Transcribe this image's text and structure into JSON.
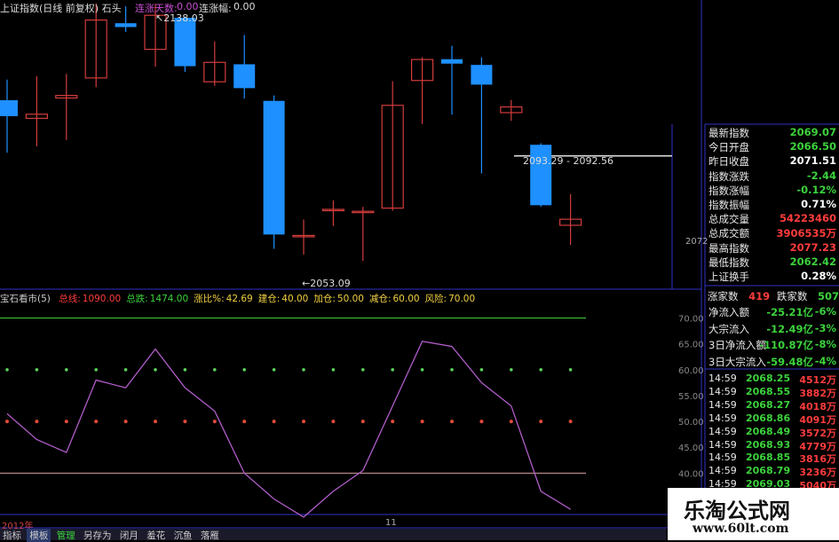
{
  "colors": {
    "up": "#d23c3c",
    "down": "#1e90ff",
    "purple": "#b05cc8",
    "green_dot": "#5ad25a",
    "red_dot": "#e84a3a",
    "frame": "#3232c8",
    "val_red": "#ff3c3c",
    "val_green": "#3cd23c",
    "yellow": "#f0d040"
  },
  "header": {
    "title": "上证指数(日线 前复权) 石头",
    "consec_days_label": "连涨天数:",
    "consec_days_value": "0.00",
    "consec_amp_label": "连涨幅:",
    "consec_amp_value": "0.00"
  },
  "price_annotations": {
    "high": "2138.03",
    "low": "←2053.09",
    "line_label": "2093.29 - 2092.56",
    "right_axis": "2072"
  },
  "chart_data": [
    {
      "type": "candlestick",
      "title": "上证指数(日线 前复权)",
      "ylim": [
        2050,
        2142
      ],
      "candles": [
        {
          "o": 2110.5,
          "c": 2105.5,
          "h": 2117.0,
          "l": 2094.0
        },
        {
          "o": 2104.8,
          "c": 2106.1,
          "h": 2118.0,
          "l": 2096.0
        },
        {
          "o": 2111.2,
          "c": 2112.0,
          "h": 2118.8,
          "l": 2098.0
        },
        {
          "o": 2117.5,
          "c": 2135.7,
          "h": 2141.0,
          "l": 2114.6
        },
        {
          "o": 2134.7,
          "c": 2133.5,
          "h": 2140.0,
          "l": 2132.0
        },
        {
          "o": 2126.5,
          "c": 2137.2,
          "h": 2140.8,
          "l": 2121.0
        },
        {
          "o": 2136.4,
          "c": 2121.2,
          "h": 2136.8,
          "l": 2119.4
        },
        {
          "o": 2116.3,
          "c": 2122.4,
          "h": 2129.0,
          "l": 2115.0
        },
        {
          "o": 2121.8,
          "c": 2114.3,
          "h": 2131.0,
          "l": 2111.0
        },
        {
          "o": 2110.3,
          "c": 2068.3,
          "h": 2112.0,
          "l": 2063.8
        },
        {
          "o": 2068.0,
          "c": 2068.0,
          "h": 2073.0,
          "l": 2062.0
        },
        {
          "o": 2076.2,
          "c": 2076.2,
          "h": 2079.0,
          "l": 2071.0
        },
        {
          "o": 2075.6,
          "c": 2075.6,
          "h": 2077.0,
          "l": 2060.0
        },
        {
          "o": 2076.6,
          "c": 2108.9,
          "h": 2116.5,
          "l": 2075.8
        },
        {
          "o": 2116.7,
          "c": 2123.3,
          "h": 2124.0,
          "l": 2103.0
        },
        {
          "o": 2123.4,
          "c": 2122.0,
          "h": 2127.6,
          "l": 2106.0
        },
        {
          "o": 2121.6,
          "c": 2115.4,
          "h": 2124.0,
          "l": 2087.5
        },
        {
          "o": 2106.6,
          "c": 2108.4,
          "h": 2110.6,
          "l": 2104.0
        },
        {
          "o": 2096.5,
          "c": 2077.5,
          "h": 2097.0,
          "l": 2077.0
        },
        {
          "o": 2071.2,
          "c": 2073.1,
          "h": 2081.0,
          "l": 2065.0
        }
      ],
      "hline": {
        "value": 2093.0,
        "label": "2093.29 - 2092.56"
      },
      "high_label": {
        "value": 2138.03,
        "index": 5
      },
      "low_label": {
        "value": 2053.09,
        "index": 11
      }
    },
    {
      "type": "line",
      "title": "宝石看市(5)",
      "ylim": [
        32,
        73
      ],
      "yticks": [
        35,
        40,
        45,
        50,
        55,
        60,
        65,
        70
      ],
      "tick_labels": [
        "35.00",
        "40.00",
        "45.00",
        "50.00",
        "55.00",
        "60.00",
        "65.00",
        "70.00"
      ],
      "series": [
        {
          "values": [
            51.5,
            46.5,
            44.0,
            58.0,
            56.5,
            64.0,
            56.5,
            52.0,
            40.0,
            35.0,
            31.5,
            36.5,
            40.5,
            53.0,
            65.5,
            64.5,
            57.5,
            53.0,
            36.5,
            33.0
          ]
        }
      ],
      "hlines": [
        70.0,
        40.0
      ],
      "dots_green": 60.0,
      "dots_red": 50.0,
      "x_labels": [
        "2012年",
        "11"
      ]
    }
  ],
  "indicator_bar": {
    "name": "宝石看市(5)",
    "items": [
      {
        "label": "总线:",
        "value": "1090.00",
        "color": "#ff3c3c"
      },
      {
        "label": "总跌:",
        "value": "1474.00",
        "color": "#3cd23c"
      },
      {
        "label": "涨比%:",
        "value": "42.69",
        "color": "#f0d040"
      },
      {
        "label": "建仓:",
        "value": "40.00",
        "color": "#f0d040"
      },
      {
        "label": "加仓:",
        "value": "50.00",
        "color": "#f0d040"
      },
      {
        "label": "减仓:",
        "value": "60.00",
        "color": "#f0d040"
      },
      {
        "label": "风险:",
        "value": "70.00",
        "color": "#f0d040"
      }
    ]
  },
  "info_panel": [
    {
      "label": "最新指数",
      "value": "2069.07",
      "color": "#3cd23c"
    },
    {
      "label": "今日开盘",
      "value": "2066.50",
      "color": "#3cd23c"
    },
    {
      "label": "昨日收盘",
      "value": "2071.51",
      "color": "#ffffff"
    },
    {
      "label": "指数涨跌",
      "value": "-2.44",
      "color": "#3cd23c"
    },
    {
      "label": "指数涨幅",
      "value": "-0.12%",
      "color": "#3cd23c"
    },
    {
      "label": "指数振幅",
      "value": "0.71%",
      "color": "#ffffff"
    },
    {
      "label": "总成交量",
      "value": "54223460",
      "color": "#ff3c3c"
    },
    {
      "label": "总成交额",
      "value": "3906535万",
      "color": "#ff3c3c"
    },
    {
      "label": "最高指数",
      "value": "2077.23",
      "color": "#ff3c3c"
    },
    {
      "label": "最低指数",
      "value": "2062.42",
      "color": "#3cd23c"
    },
    {
      "label": "上证换手",
      "value": "0.28%",
      "color": "#ffffff"
    }
  ],
  "updown": {
    "up_label": "涨家数",
    "up_value": "419",
    "down_label": "跌家数",
    "down_value": "507"
  },
  "flows": [
    {
      "label": "净流入额",
      "value": "-25.21亿",
      "pct": "-6%"
    },
    {
      "label": "大宗流入",
      "value": "-12.49亿",
      "pct": "-3%"
    },
    {
      "label": "3日净流入额",
      "value": "-110.87亿",
      "pct": "-8%"
    },
    {
      "label": "3日大宗流入",
      "value": "-59.48亿",
      "pct": "-4%"
    }
  ],
  "ticks": [
    {
      "time": "14:59",
      "price": "2068.25",
      "vol": "4512万"
    },
    {
      "time": "14:59",
      "price": "2068.55",
      "vol": "3882万"
    },
    {
      "time": "14:59",
      "price": "2068.27",
      "vol": "4018万"
    },
    {
      "time": "14:59",
      "price": "2068.86",
      "vol": "4091万"
    },
    {
      "time": "14:59",
      "price": "2068.49",
      "vol": "3572万"
    },
    {
      "time": "14:59",
      "price": "2068.93",
      "vol": "4779万"
    },
    {
      "time": "14:59",
      "price": "2068.85",
      "vol": "3816万"
    },
    {
      "time": "14:59",
      "price": "2068.79",
      "vol": "3236万"
    },
    {
      "time": "14:59",
      "price": "2069.03",
      "vol": "5040万"
    }
  ],
  "bottom_tabs": [
    "指标",
    "模板",
    "管理",
    "另存为",
    "闭月",
    "羞花",
    "沉鱼",
    "落雁"
  ],
  "watermark": {
    "title": "乐淘公式网",
    "url": "www.60lt.com"
  }
}
